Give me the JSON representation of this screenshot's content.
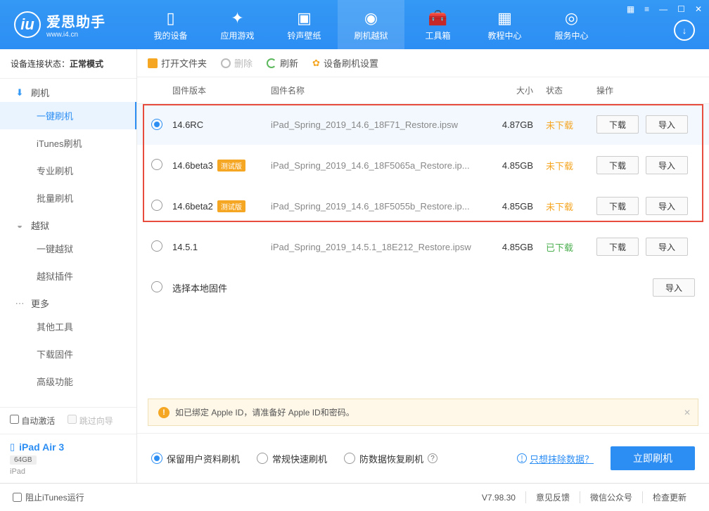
{
  "app": {
    "name": "爱思助手",
    "site": "www.i4.cn"
  },
  "topnav": [
    {
      "label": "我的设备"
    },
    {
      "label": "应用游戏"
    },
    {
      "label": "铃声壁纸"
    },
    {
      "label": "刷机越狱"
    },
    {
      "label": "工具箱"
    },
    {
      "label": "教程中心"
    },
    {
      "label": "服务中心"
    }
  ],
  "sidebar": {
    "status_label": "设备连接状态：",
    "status_value": "正常模式",
    "groups": [
      {
        "title": "刷机",
        "items": [
          "一键刷机",
          "iTunes刷机",
          "专业刷机",
          "批量刷机"
        ]
      },
      {
        "title": "越狱",
        "items": [
          "一键越狱",
          "越狱插件"
        ]
      },
      {
        "title": "更多",
        "items": [
          "其他工具",
          "下载固件",
          "高级功能"
        ]
      }
    ],
    "auto_activate": "自动激活",
    "skip_guide": "跳过向导",
    "device": {
      "name": "iPad Air 3",
      "storage": "64GB",
      "type": "iPad"
    }
  },
  "toolbar": {
    "open": "打开文件夹",
    "delete": "删除",
    "refresh": "刷新",
    "settings": "设备刷机设置"
  },
  "table": {
    "headers": {
      "version": "固件版本",
      "name": "固件名称",
      "size": "大小",
      "status": "状态",
      "ops": "操作"
    },
    "rows": [
      {
        "selected": true,
        "version": "14.6RC",
        "beta": false,
        "name": "iPad_Spring_2019_14.6_18F71_Restore.ipsw",
        "size": "4.87GB",
        "status": "未下载",
        "status_class": "status-no",
        "dl": "下载",
        "imp": "导入"
      },
      {
        "selected": false,
        "version": "14.6beta3",
        "beta": true,
        "name": "iPad_Spring_2019_14.6_18F5065a_Restore.ip...",
        "size": "4.85GB",
        "status": "未下载",
        "status_class": "status-no",
        "dl": "下载",
        "imp": "导入"
      },
      {
        "selected": false,
        "version": "14.6beta2",
        "beta": true,
        "name": "iPad_Spring_2019_14.6_18F5055b_Restore.ip...",
        "size": "4.85GB",
        "status": "未下载",
        "status_class": "status-no",
        "dl": "下载",
        "imp": "导入"
      },
      {
        "selected": false,
        "version": "14.5.1",
        "beta": false,
        "name": "iPad_Spring_2019_14.5.1_18E212_Restore.ipsw",
        "size": "4.85GB",
        "status": "已下载",
        "status_class": "status-yes",
        "dl": "下载",
        "imp": "导入"
      }
    ],
    "local_row": {
      "label": "选择本地固件",
      "imp": "导入"
    },
    "beta_tag": "测试版"
  },
  "notice": "如已绑定 Apple ID，请准备好 Apple ID和密码。",
  "options": {
    "opt1": "保留用户资料刷机",
    "opt2": "常规快速刷机",
    "opt3": "防数据恢复刷机",
    "erase_link": "只想抹除数据？",
    "flash_btn": "立即刷机"
  },
  "footer": {
    "block_itunes": "阻止iTunes运行",
    "version": "V7.98.30",
    "feedback": "意见反馈",
    "wechat": "微信公众号",
    "update": "检查更新"
  }
}
